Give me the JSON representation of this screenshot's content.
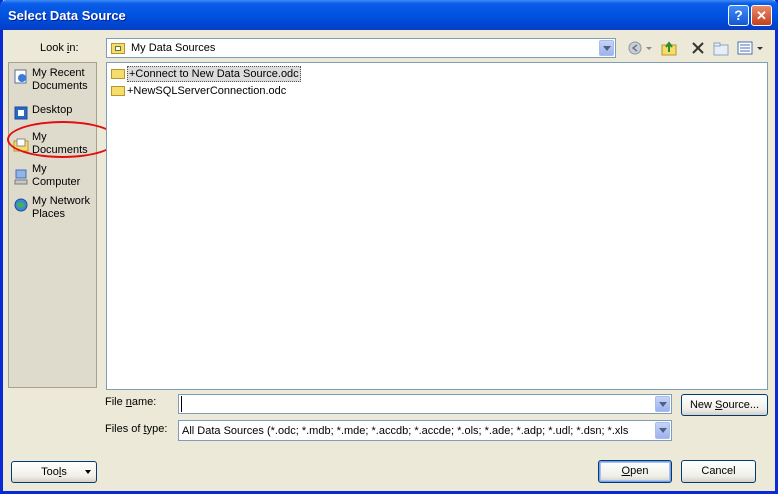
{
  "window": {
    "title": "Select Data Source",
    "help_label": "?",
    "close_label": "✕"
  },
  "lookin": {
    "label_pre": "Look ",
    "label_u": "i",
    "label_post": "n:",
    "value": "My Data Sources"
  },
  "places": [
    {
      "label_line1": "My Recent",
      "label_line2": "Documents",
      "icon": "recent-documents-icon"
    },
    {
      "label_line1": "Desktop",
      "label_line2": "",
      "icon": "desktop-icon"
    },
    {
      "label_line1": "My",
      "label_line2": "Documents",
      "icon": "my-documents-icon"
    },
    {
      "label_line1": "My",
      "label_line2": "Computer",
      "icon": "my-computer-icon"
    },
    {
      "label_line1": "My Network",
      "label_line2": "Places",
      "icon": "network-places-icon"
    }
  ],
  "files": [
    {
      "name": "+Connect to New Data Source.odc",
      "selected": true
    },
    {
      "name": "+NewSQLServerConnection.odc",
      "selected": false
    }
  ],
  "filename": {
    "label_pre": "File ",
    "label_u": "n",
    "label_post": "ame:",
    "value": ""
  },
  "filetype": {
    "label_pre": "Files of ",
    "label_u": "t",
    "label_post": "ype:",
    "value": "All Data Sources (*.odc; *.mdb; *.mde; *.accdb; *.accde; *.ols; *.ade; *.adp; *.udl; *.dsn; *.xls"
  },
  "buttons": {
    "new_source_pre": "New ",
    "new_source_u": "S",
    "new_source_post": "ource...",
    "tools_pre": "Too",
    "tools_u": "l",
    "tools_post": "s",
    "open_u": "O",
    "open_post": "pen",
    "cancel": "Cancel"
  },
  "annotation": {
    "color": "#e01010"
  }
}
